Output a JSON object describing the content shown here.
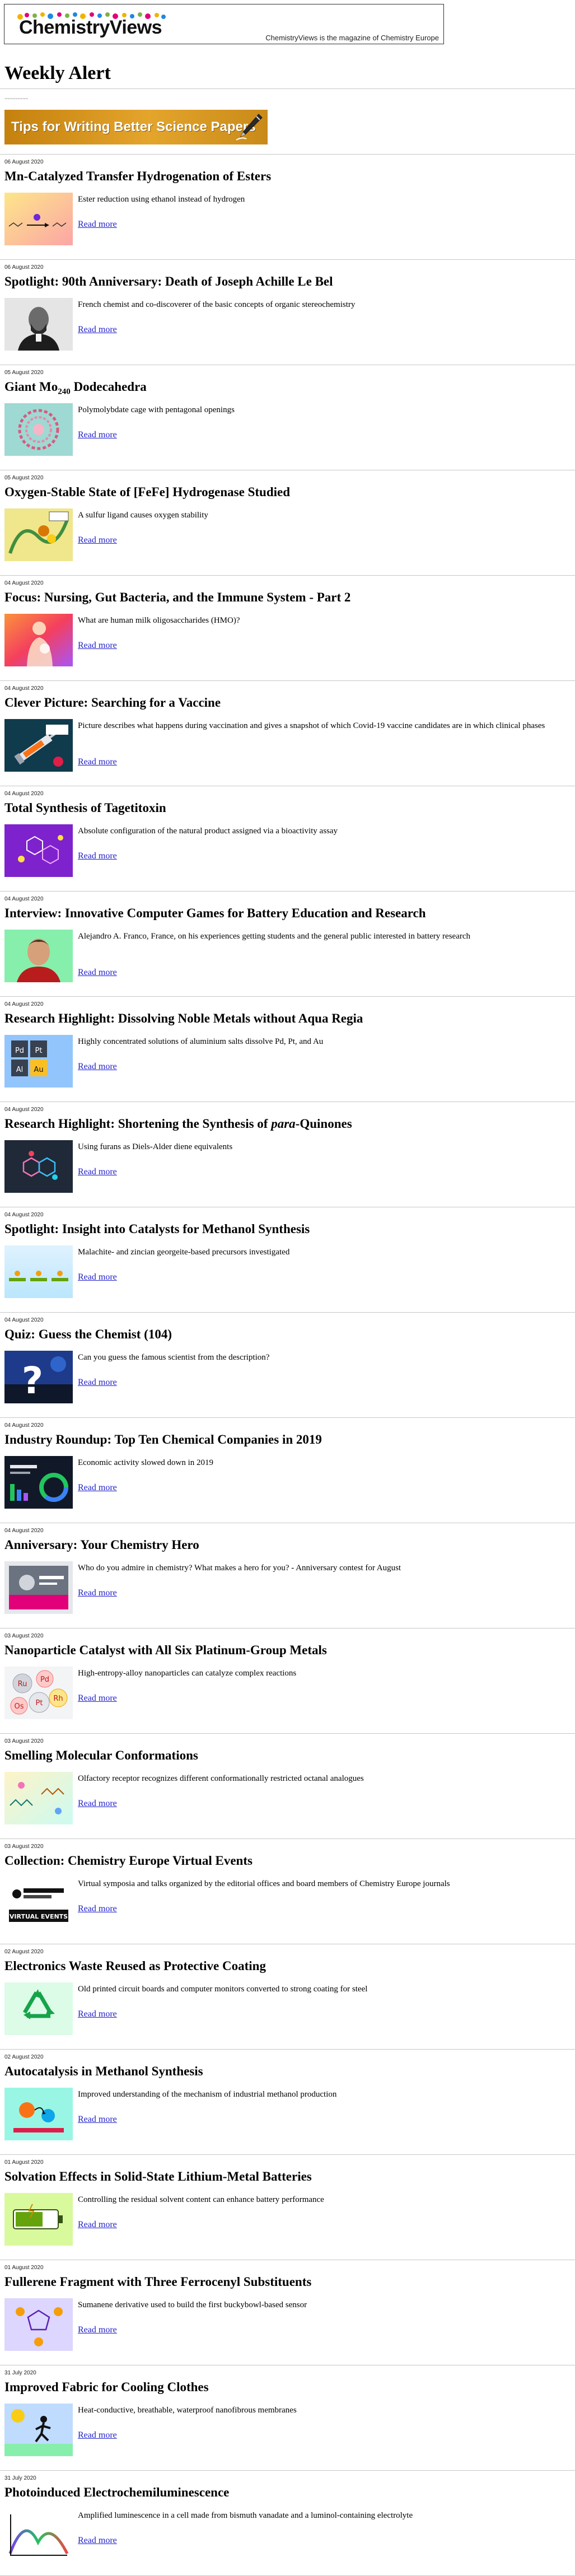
{
  "header": {
    "logo_text": "ChemistryViews",
    "tagline": "ChemistryViews is the magazine of Chemistry Europe"
  },
  "page_title": "Weekly Alert",
  "banner_text": "Tips for Writing Better Science Papers",
  "read_more_label": "Read more",
  "colors": {
    "link": "#2222cc",
    "rule": "#c7c7c7",
    "banner": "#d9961d"
  },
  "articles": [
    {
      "date": "06 August 2020",
      "title": "Mn-Catalyzed Transfer Hydrogenation of Esters",
      "teaser": "Ester reduction using ethanol instead of hydrogen",
      "thumb": "reaction-scheme"
    },
    {
      "date": "06 August 2020",
      "title": "Spotlight: 90th Anniversary: Death of Joseph Achille Le Bel",
      "teaser": "French chemist and co-discoverer of the basic concepts of organic stereochemistry",
      "thumb": "portrait-bw"
    },
    {
      "date": "05 August 2020",
      "title": "Giant Mo",
      "title_sub": "240",
      "title_after": " Dodecahedra",
      "teaser": "Polymolybdate cage with pentagonal openings",
      "thumb": "molecular-cage"
    },
    {
      "date": "05 August 2020",
      "title": "Oxygen-Stable State of [FeFe] Hydrogenase Studied",
      "teaser": "A sulfur ligand causes oxygen stability",
      "thumb": "enzyme-cluster"
    },
    {
      "date": "04 August 2020",
      "title": "Focus: Nursing, Gut Bacteria, and the Immune System - Part 2",
      "teaser": "What are human milk oligosaccharides (HMO)?",
      "thumb": "nursing-silhouette"
    },
    {
      "date": "04 August 2020",
      "title": "Clever Picture: Searching for a Vaccine",
      "teaser": "Picture describes what happens during vaccination and gives a snapshot of which Covid-19 vaccine candidates are in which clinical phases",
      "thumb": "vaccine-syringe"
    },
    {
      "date": "04 August 2020",
      "title": "Total Synthesis of Tagetitoxin",
      "teaser": "Absolute configuration of the natural product assigned via a bioactivity assay",
      "thumb": "molecule-purple"
    },
    {
      "date": "04 August 2020",
      "title": "Interview: Innovative Computer Games for Battery Education and Research",
      "teaser": "Alejandro A. Franco, France, on his experiences getting students and the general public interested in battery research",
      "thumb": "portrait-color"
    },
    {
      "date": "04 August 2020",
      "title": "Research Highlight: Dissolving Noble Metals without Aqua Regia",
      "teaser": "Highly concentrated solutions of aluminium salts dissolve Pd, Pt, and Au",
      "thumb": "element-tiles"
    },
    {
      "date": "04 August 2020",
      "title": "Research Highlight: Shortening the Synthesis of ",
      "title_em": "para",
      "title_after": "-Quinones",
      "teaser": "Using furans as Diels-Alder diene equivalents",
      "thumb": "molecule-dark"
    },
    {
      "date": "04 August 2020",
      "title": "Spotlight: Insight into Catalysts for Methanol Synthesis",
      "teaser": "Malachite- and zincian georgeite-based precursors investigated",
      "thumb": "catalyst-platforms"
    },
    {
      "date": "04 August 2020",
      "title": "Quiz: Guess the Chemist (104)",
      "teaser": "Can you guess the famous scientist from the description?",
      "thumb": "question-mark"
    },
    {
      "date": "04 August 2020",
      "title": "Industry Roundup: Top Ten Chemical Companies in 2019",
      "teaser": "Economic activity slowed down in 2019",
      "thumb": "dark-infographic"
    },
    {
      "date": "04 August 2020",
      "title": "Anniversary: Your Chemistry Hero",
      "teaser": "Who do you admire in chemistry? What makes a hero for you? - Anniversary contest for August",
      "thumb": "hero-poster"
    },
    {
      "date": "03 August 2020",
      "title": "Nanoparticle Catalyst with All Six Platinum-Group Metals",
      "teaser": "High-entropy-alloy nanoparticles can catalyze complex reactions",
      "thumb": "pgm-spheres"
    },
    {
      "date": "03 August 2020",
      "title": "Smelling Molecular Conformations",
      "teaser": "Olfactory receptor recognizes different conformationally restricted octanal analogues",
      "thumb": "molecule-pastel"
    },
    {
      "date": "03 August 2020",
      "title": "Collection: Chemistry Europe Virtual Events",
      "teaser": "Virtual symposia and talks organized by the editorial offices and board members of Chemistry Europe journals",
      "thumb": "events-logo"
    },
    {
      "date": "02 August 2020",
      "title": "Electronics Waste Reused as Protective Coating",
      "teaser": "Old printed circuit boards and computer monitors converted to strong coating for steel",
      "thumb": "recycle-symbol"
    },
    {
      "date": "02 August 2020",
      "title": "Autocatalysis in Methanol Synthesis",
      "teaser": "Improved understanding of the mechanism of industrial methanol production",
      "thumb": "mechanism-teal"
    },
    {
      "date": "01 August 2020",
      "title": "Solvation Effects in Solid-State Lithium-Metal Batteries",
      "teaser": "Controlling the residual solvent content can enhance battery performance",
      "thumb": "battery-green"
    },
    {
      "date": "01 August 2020",
      "title": "Fullerene Fragment with Three Ferrocenyl Substituents",
      "teaser": "Sumanene derivative used to build the first buckybowl-based sensor",
      "thumb": "molecule-lilac"
    },
    {
      "date": "31 July 2020",
      "title": "Improved Fabric for Cooling Clothes",
      "teaser": "Heat-conductive, breathable, waterproof nanofibrous membranes",
      "thumb": "runner-sun"
    },
    {
      "date": "31 July 2020",
      "title": "Photoinduced Electrochemiluminescence",
      "teaser": "Amplified luminescence in a cell made from bismuth vanadate and a luminol-containing electrolyte",
      "thumb": "spectrum-glow"
    }
  ]
}
